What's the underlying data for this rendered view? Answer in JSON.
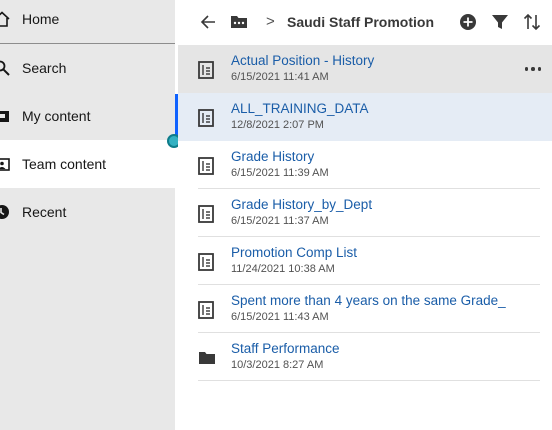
{
  "sidebar": {
    "items": [
      {
        "label": "Home",
        "icon": "home-icon"
      },
      {
        "label": "Search",
        "icon": "search-icon"
      },
      {
        "label": "My content",
        "icon": "folder-icon"
      },
      {
        "label": "Team content",
        "icon": "team-folder-icon"
      },
      {
        "label": "Recent",
        "icon": "clock-icon"
      }
    ],
    "active": "Team content"
  },
  "toolbar": {
    "title": "Saudi Staff Promotion",
    "separator": ">"
  },
  "list": [
    {
      "name": "Actual Position - History",
      "date": "6/15/2021 11:41 AM",
      "icon": "report-icon",
      "state": "hover"
    },
    {
      "name": "ALL_TRAINING_DATA",
      "date": "12/8/2021 2:07 PM",
      "icon": "report-icon",
      "state": "selected"
    },
    {
      "name": "Grade History",
      "date": "6/15/2021 11:39 AM",
      "icon": "report-icon"
    },
    {
      "name": "Grade History_by_Dept",
      "date": "6/15/2021 11:37 AM",
      "icon": "report-icon"
    },
    {
      "name": "Promotion Comp List",
      "date": "11/24/2021 10:38 AM",
      "icon": "report-icon"
    },
    {
      "name": "Spent more than 4 years on the same Grade_",
      "date": "6/15/2021 11:43 AM",
      "icon": "report-icon"
    },
    {
      "name": "Staff Performance",
      "date": "10/3/2021 8:27 AM",
      "icon": "folder-icon"
    }
  ],
  "colors": {
    "sidebar_bg": "#e8e8e8",
    "link": "#1a5da8",
    "accent": "#0f62fe",
    "knob": "#33b1c2"
  }
}
